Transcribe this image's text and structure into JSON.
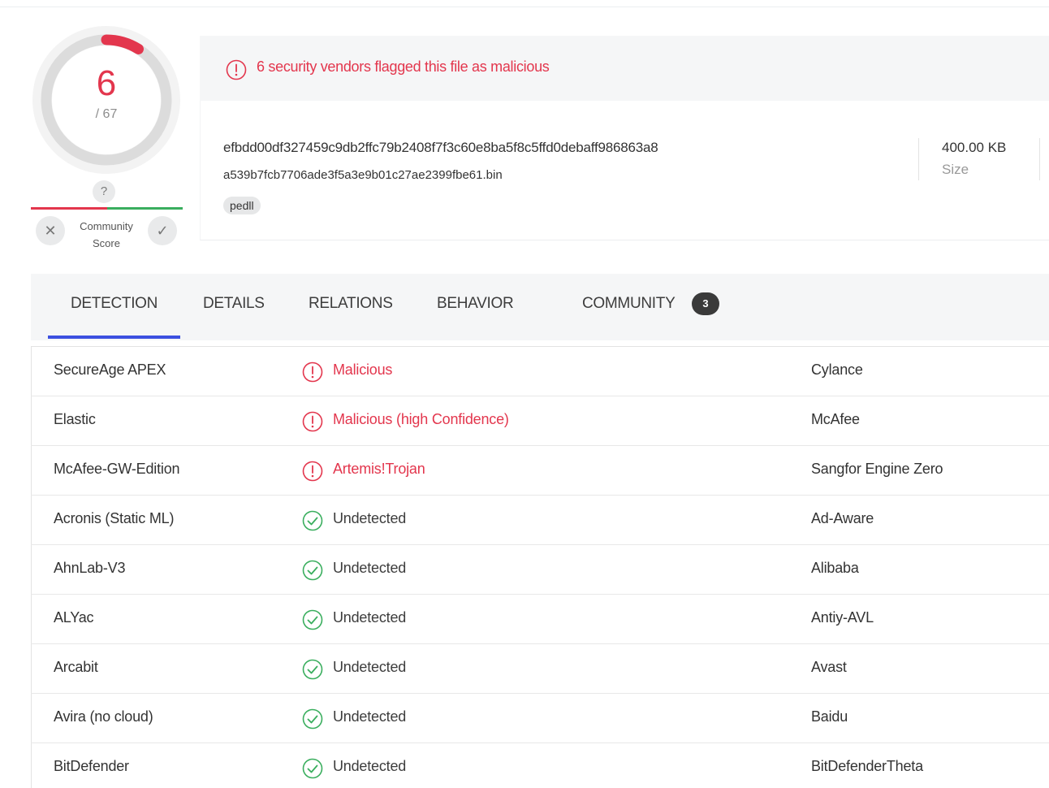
{
  "score": {
    "detections": "6",
    "total": "/ 67",
    "ring_fraction": 0.0896,
    "color": "#e3364d"
  },
  "community": {
    "unknown_badge": "?",
    "label_line1": "Community",
    "label_line2": "Score",
    "down_icon": "close-icon",
    "up_icon": "check-icon"
  },
  "alert": {
    "icon": "alert-circle-icon",
    "text": "6 security vendors flagged this file as malicious"
  },
  "file": {
    "hash": "efbdd00df327459c9db2ffc79b2408f7f3c60e8ba5f8c5ffd0debaff986863a8",
    "name": "a539b7fcb7706ade3f5a3e9b01c27ae2399fbe61.bin",
    "tag": "pedll",
    "size_value": "400.00 KB",
    "size_label": "Size"
  },
  "tabs": [
    {
      "label": "DETECTION",
      "active": true
    },
    {
      "label": "DETAILS"
    },
    {
      "label": "RELATIONS"
    },
    {
      "label": "BEHAVIOR"
    },
    {
      "label": "COMMUNITY",
      "badge": "3"
    }
  ],
  "colors": {
    "malicious": "#e3364d",
    "clean": "#3aae5e",
    "tab_accent": "#3c50e0"
  },
  "detections": [
    {
      "vendor": "SecureAge APEX",
      "result": "Malicious",
      "status": "malicious",
      "vendor2": "Cylance"
    },
    {
      "vendor": "Elastic",
      "result": "Malicious (high Confidence)",
      "status": "malicious",
      "vendor2": "McAfee"
    },
    {
      "vendor": "McAfee-GW-Edition",
      "result": "Artemis!Trojan",
      "status": "malicious",
      "vendor2": "Sangfor Engine Zero"
    },
    {
      "vendor": "Acronis (Static ML)",
      "result": "Undetected",
      "status": "clean",
      "vendor2": "Ad-Aware"
    },
    {
      "vendor": "AhnLab-V3",
      "result": "Undetected",
      "status": "clean",
      "vendor2": "Alibaba"
    },
    {
      "vendor": "ALYac",
      "result": "Undetected",
      "status": "clean",
      "vendor2": "Antiy-AVL"
    },
    {
      "vendor": "Arcabit",
      "result": "Undetected",
      "status": "clean",
      "vendor2": "Avast"
    },
    {
      "vendor": "Avira (no cloud)",
      "result": "Undetected",
      "status": "clean",
      "vendor2": "Baidu"
    },
    {
      "vendor": "BitDefender",
      "result": "Undetected",
      "status": "clean",
      "vendor2": "BitDefenderTheta"
    }
  ]
}
